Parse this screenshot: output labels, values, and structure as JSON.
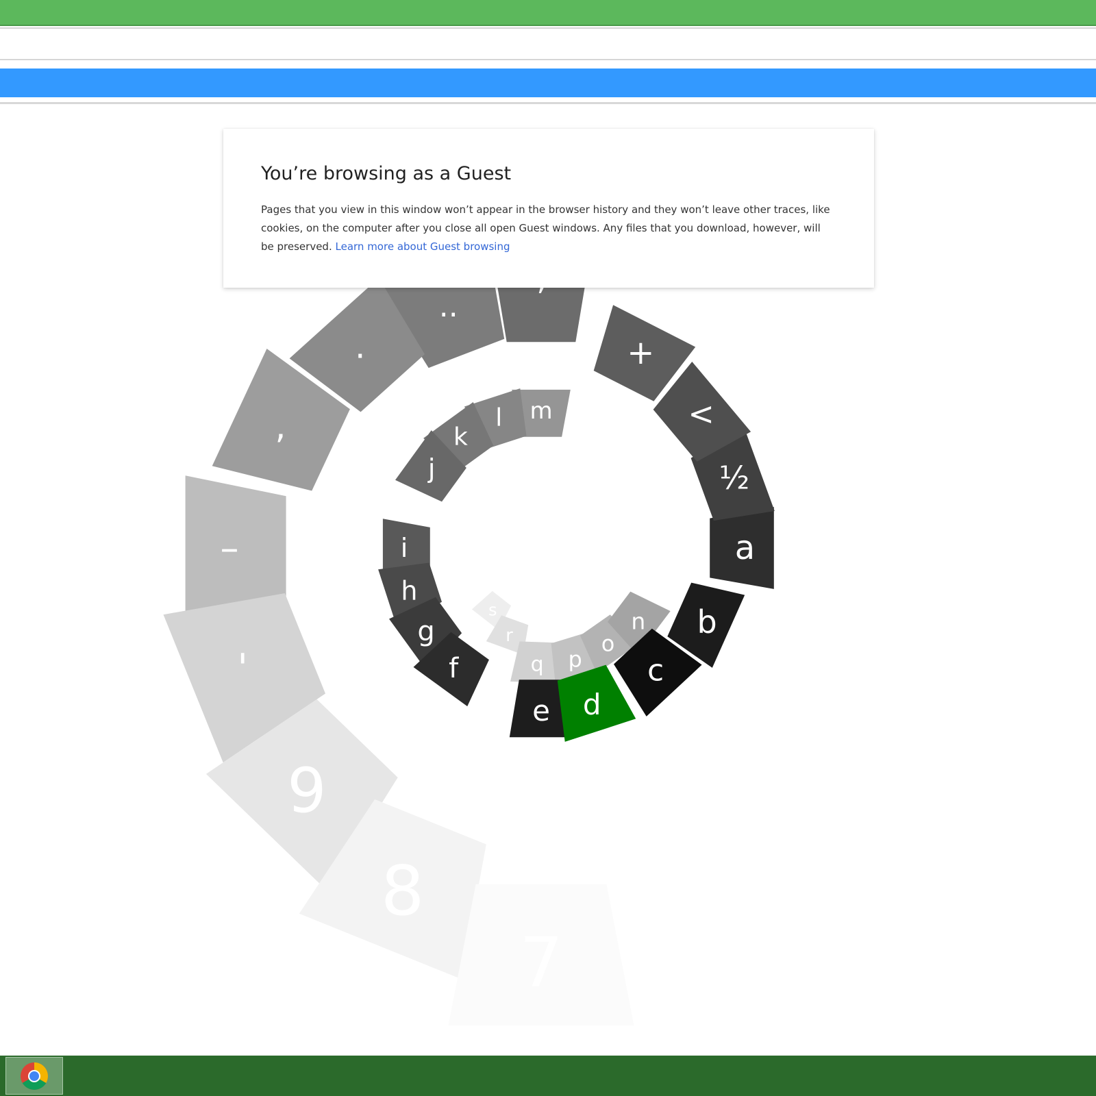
{
  "guest_card": {
    "title": "You’re browsing as a Guest",
    "body": "Pages that you view in this window won’t appear in the browser history and they won’t leave other traces, like cookies, on the computer after you close all open Guest windows. Any files that you download, however, will be preserved.",
    "link_text": "Learn more about Guest browsing"
  },
  "keyboard": {
    "selected_key": "d",
    "selected_color": "#008000",
    "keys": [
      {
        "label": "s",
        "shade": "#eeeeee"
      },
      {
        "label": "r",
        "shade": "#e0e0e0"
      },
      {
        "label": "q",
        "shade": "#d1d1d1"
      },
      {
        "label": "p",
        "shade": "#c2c2c2"
      },
      {
        "label": "o",
        "shade": "#b3b3b3"
      },
      {
        "label": "n",
        "shade": "#a4a4a4"
      },
      {
        "label": "m",
        "shade": "#959595"
      },
      {
        "label": "l",
        "shade": "#868686"
      },
      {
        "label": "k",
        "shade": "#777777"
      },
      {
        "label": "j",
        "shade": "#686868"
      },
      {
        "label": "i",
        "shade": "#595959"
      },
      {
        "label": "h",
        "shade": "#4a4a4a"
      },
      {
        "label": "g",
        "shade": "#3b3b3b"
      },
      {
        "label": "f",
        "shade": "#2c2c2c"
      },
      {
        "label": "e",
        "shade": "#1d1d1d"
      },
      {
        "label": "d",
        "shade": "#008000"
      },
      {
        "label": "c",
        "shade": "#0e0e0e"
      },
      {
        "label": "b",
        "shade": "#1c1c1c"
      },
      {
        "label": "a",
        "shade": "#2e2e2e"
      },
      {
        "label": "½",
        "shade": "#404040"
      },
      {
        "label": "<",
        "shade": "#4f4f4f"
      },
      {
        "label": "+",
        "shade": "#5d5d5d"
      },
      {
        "label": "’",
        "shade": "#6c6c6c"
      },
      {
        "label": "..",
        "shade": "#7c7c7c"
      },
      {
        "label": ".",
        "shade": "#8b8b8b"
      },
      {
        "label": ",",
        "shade": "#9d9d9d"
      },
      {
        "label": "–",
        "shade": "#bdbdbd"
      },
      {
        "label": "'",
        "shade": "#d4d4d4"
      },
      {
        "label": "9",
        "shade": "#e6e6e6"
      },
      {
        "label": "8",
        "shade": "#f3f3f3"
      },
      {
        "label": "7",
        "shade": "#fbfbfb"
      }
    ]
  },
  "taskbar": {
    "app_icon": "chrome-icon"
  }
}
